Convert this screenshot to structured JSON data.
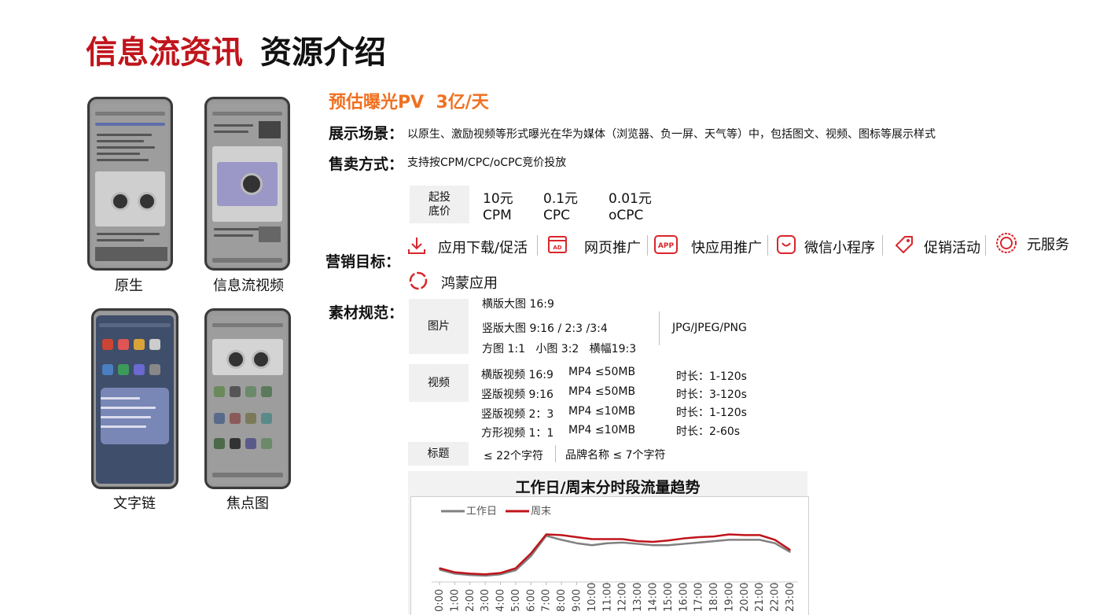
{
  "title": {
    "red": "信息流资讯",
    "black": "资源介绍"
  },
  "phones": [
    {
      "label": "原生"
    },
    {
      "label": "信息流视频"
    },
    {
      "label": "文字链"
    },
    {
      "label": "焦点图"
    }
  ],
  "headline": "预估曝光PV  3亿/天",
  "scene": {
    "label": "展示场景：",
    "text": "以原生、激励视频等形式曝光在华为媒体（浏览器、负一屏、天气等）中，包括图文、视频、图标等展示样式"
  },
  "sale": {
    "label": "售卖方式：",
    "text": "支持按CPM/CPC/oCPC竞价投放"
  },
  "floor": {
    "label": "起投\n底价",
    "items": [
      {
        "price": "10元",
        "unit": "CPM"
      },
      {
        "price": "0.1元",
        "unit": "CPC"
      },
      {
        "price": "0.01元",
        "unit": "oCPC"
      }
    ]
  },
  "marketing": {
    "label": "营销目标：",
    "items": [
      {
        "icon": "download-icon",
        "text": "应用下载/促活"
      },
      {
        "icon": "web-ad-icon",
        "text": "网页推广"
      },
      {
        "icon": "app-icon",
        "text": "快应用推广"
      },
      {
        "icon": "mini-program-icon",
        "text": "微信小程序"
      },
      {
        "icon": "tag-icon",
        "text": "促销活动"
      },
      {
        "icon": "service-ring-icon",
        "text": "元服务"
      },
      {
        "icon": "harmony-ring-icon",
        "text": "鸿蒙应用"
      }
    ],
    "colors": {
      "icon": "#d9262c"
    }
  },
  "material": {
    "label": "素材规范：",
    "image": {
      "label": "图片",
      "rows": [
        "横版大图 16:9",
        "竖版大图 9:16 / 2:3 /3:4",
        "方图 1:1   小图 3:2   横幅19:3"
      ],
      "format": "JPG/JPEG/PNG"
    },
    "video": {
      "label": "视频",
      "rows": [
        {
          "name": "横版视频 16:9",
          "spec": "MP4 ≤50MB",
          "duration": "时长：1-120s"
        },
        {
          "name": "竖版视频 9:16",
          "spec": "MP4 ≤50MB",
          "duration": "时长：3-120s"
        },
        {
          "name": "竖版视频 2：3",
          "spec": "MP4 ≤10MB",
          "duration": "时长：1-120s"
        },
        {
          "name": "方形视频 1：1",
          "spec": "MP4 ≤10MB",
          "duration": "时长：2-60s"
        }
      ]
    },
    "heading": {
      "label": "标题",
      "limit": "≤ 22个字符",
      "brand": "品牌名称 ≤ 7个字符"
    }
  },
  "chart_data": {
    "type": "line",
    "title": "工作日/周末分时段流量趋势",
    "x": [
      "0:00",
      "1:00",
      "2:00",
      "3:00",
      "4:00",
      "5:00",
      "6:00",
      "7:00",
      "8:00",
      "9:00",
      "10:00",
      "11:00",
      "12:00",
      "13:00",
      "14:00",
      "15:00",
      "16:00",
      "17:00",
      "18:00",
      "19:00",
      "20:00",
      "21:00",
      "22:00",
      "23:00"
    ],
    "series": [
      {
        "name": "工作日",
        "color": "#808080",
        "values": [
          16,
          10,
          8,
          7,
          9,
          15,
          36,
          66,
          60,
          55,
          52,
          55,
          56,
          54,
          52,
          52,
          54,
          56,
          58,
          60,
          60,
          60,
          55,
          42
        ]
      },
      {
        "name": "周末",
        "color": "#c0141b",
        "values": [
          18,
          12,
          10,
          9,
          11,
          18,
          40,
          68,
          67,
          64,
          61,
          61,
          61,
          58,
          57,
          59,
          62,
          64,
          65,
          68,
          67,
          67,
          60,
          45
        ]
      }
    ],
    "ylim": [
      0,
      100
    ],
    "grid": false,
    "legend": "top-left"
  }
}
